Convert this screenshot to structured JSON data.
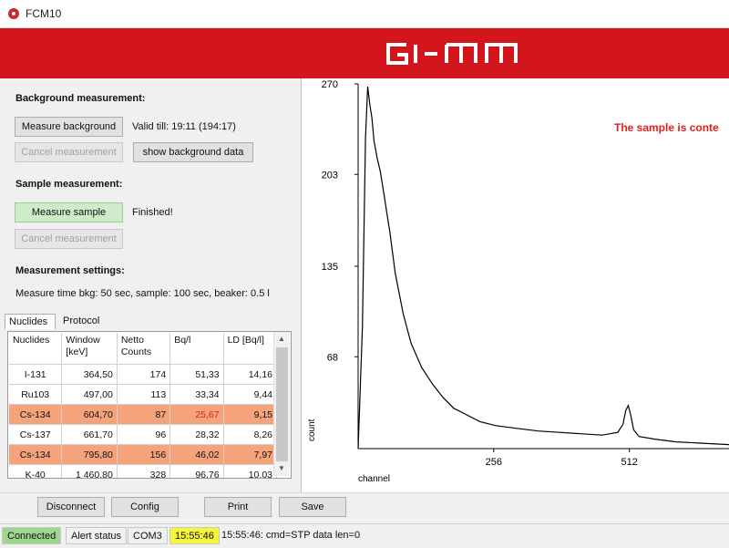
{
  "window": {
    "title": "FCM10"
  },
  "banner": {
    "logo_text": "GI-MM",
    "color": "#d4151c"
  },
  "background": {
    "section_title": "Background measurement:",
    "measure_button": "Measure background",
    "valid_text": "Valid till: 19:11 (194:17)",
    "cancel_button": "Cancel measurement",
    "show_button": "show background data"
  },
  "sample": {
    "section_title": "Sample measurement:",
    "measure_button": "Measure sample",
    "status_text": "Finished!",
    "cancel_button": "Cancel measurement"
  },
  "settings": {
    "section_title": "Measurement settings:",
    "text": "Measure time bkg: 50 sec, sample: 100 sec, beaker: 0.5 l"
  },
  "tabs": [
    {
      "label": "Nuclides"
    },
    {
      "label": "Protocol"
    }
  ],
  "table": {
    "headers": [
      "Nuclides",
      "Window [keV]",
      "Netto Counts",
      "Bq/l",
      "LD [Bq/l]"
    ],
    "rows": [
      {
        "cells": [
          "I-131",
          "364,50",
          "174",
          "51,33",
          "14,16"
        ],
        "highlight": false,
        "red_col": -1
      },
      {
        "cells": [
          "Ru103",
          "497,00",
          "113",
          "33,34",
          "9,44"
        ],
        "highlight": false,
        "red_col": -1
      },
      {
        "cells": [
          "Cs-134",
          "604,70",
          "87",
          "25,67",
          "9,15"
        ],
        "highlight": true,
        "red_col": 3
      },
      {
        "cells": [
          "Cs-137",
          "661,70",
          "96",
          "28,32",
          "8,26"
        ],
        "highlight": false,
        "red_col": -1
      },
      {
        "cells": [
          "Cs-134",
          "795,80",
          "156",
          "46,02",
          "7,97"
        ],
        "highlight": true,
        "red_col": -1
      },
      {
        "cells": [
          "K-40",
          "1 460,80",
          "328",
          "96,76",
          "10,03"
        ],
        "highlight": false,
        "red_col": -1
      }
    ],
    "highlight_color": "#f4a37a"
  },
  "bottom_buttons": {
    "disconnect": "Disconnect",
    "config": "Config",
    "print": "Print",
    "save": "Save"
  },
  "status": {
    "connection": "Connected",
    "alert": "Alert status",
    "port": "COM3",
    "time": "15:55:46",
    "message": "15:55:46: cmd=STP data len=0",
    "connected_color": "#9bd88e",
    "time_color": "#f5f53a"
  },
  "chart_data": {
    "type": "line",
    "alert_text": "The sample is conte",
    "alert_color": "#e02020",
    "xlabel": "channel",
    "ylabel": "count",
    "xticks": [
      256,
      512
    ],
    "yticks": [
      68,
      135,
      203,
      270
    ],
    "ylim": [
      0,
      270
    ],
    "xlim": [
      0,
      700
    ],
    "series": [
      {
        "x": [
          0,
          8,
          14,
          18,
          22,
          26,
          30,
          36,
          42,
          50,
          60,
          70,
          85,
          100,
          120,
          140,
          160,
          180,
          200,
          230,
          260,
          300,
          340,
          380,
          420,
          460,
          490,
          500,
          505,
          510,
          515,
          520,
          530,
          560,
          600,
          650,
          700
        ],
        "y": [
          0,
          90,
          230,
          268,
          255,
          245,
          228,
          215,
          205,
          185,
          160,
          130,
          100,
          78,
          60,
          48,
          38,
          30,
          26,
          20,
          17,
          15,
          13,
          12,
          11,
          10,
          12,
          18,
          28,
          32,
          24,
          14,
          9,
          7,
          5,
          4,
          3
        ]
      }
    ]
  }
}
